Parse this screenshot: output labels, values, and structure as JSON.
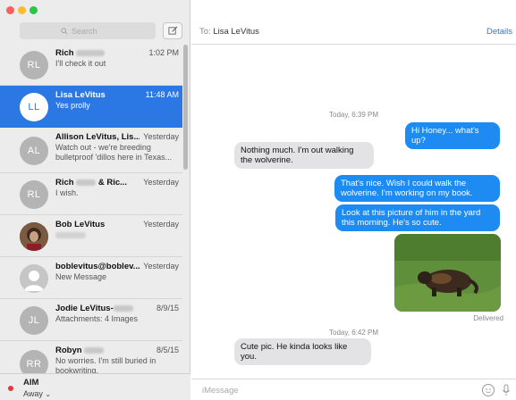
{
  "window": {
    "controls": [
      "close",
      "minimize",
      "zoom"
    ]
  },
  "sidebar": {
    "search": {
      "placeholder": "Search"
    },
    "conversations": [
      {
        "name": "Rich",
        "time": "1:02 PM",
        "preview": "I'll check it out",
        "initials": "RL"
      },
      {
        "name": "Lisa LeVitus",
        "time": "11:48 AM",
        "preview": "Yes prolly",
        "initials": "LL"
      },
      {
        "name": "Allison LeVitus, Lis...",
        "time": "Yesterday",
        "preview": "Watch out - we're breeding bulletproof 'dillos here in Texas...",
        "initials": "AL"
      },
      {
        "name": "Rich",
        "name_suffix": "& Ric...",
        "time": "Yesterday",
        "preview": "I wish.",
        "initials": "RL"
      },
      {
        "name": "Bob LeVitus",
        "time": "Yesterday",
        "preview": ""
      },
      {
        "name": "boblevitus@boblev...",
        "time": "Yesterday",
        "preview": "New Message"
      },
      {
        "name": "Jodie LeVitus-",
        "time": "8/9/15",
        "preview": "Attachments: 4 Images",
        "initials": "JL"
      },
      {
        "name": "Robyn",
        "time": "8/5/15",
        "preview": "No worries. I'm still buried in bookwriting.",
        "initials": "RR"
      }
    ],
    "status": {
      "service": "AIM",
      "state": "Away"
    }
  },
  "header": {
    "to_label": "To:",
    "recipient": "Lisa LeVitus",
    "details": "Details"
  },
  "thread": {
    "stamp1": "Today, 6:39 PM",
    "m1": "Hi Honey... what's up?",
    "m2": "Nothing much. I'm out walking the wolverine.",
    "m3": "That's nice. Wish I could walk the wolverine. I'm working on my book.",
    "m4": "Look at this picture of him in the yard this morning. He's so cute.",
    "delivered": "Delivered",
    "stamp2": "Today, 6:42 PM",
    "m5": "Cute pic. He kinda looks like you."
  },
  "composer": {
    "placeholder": "iMessage"
  },
  "colors": {
    "accent": "#2b78e4",
    "bubble_out": "#1e8bf3",
    "bubble_in": "#e3e3e6",
    "away": "#e0393e"
  },
  "icons": [
    "search-icon",
    "compose-icon",
    "chevron-down-icon",
    "emoji-icon",
    "microphone-icon"
  ]
}
